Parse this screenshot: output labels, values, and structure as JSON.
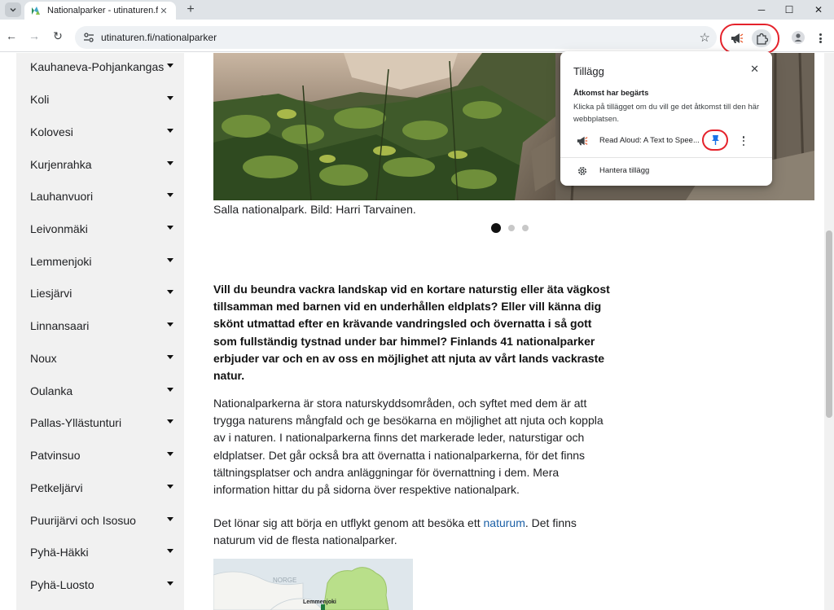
{
  "browser": {
    "tab": {
      "title": "Nationalparker - utinaturen.fi",
      "close_glyph": "✕"
    },
    "new_tab_glyph": "+",
    "window_controls": [
      "─",
      "☐",
      "✕"
    ],
    "url": "utinaturen.fi/nationalparker",
    "nav": {
      "back": "←",
      "forward": "→",
      "reload": "↻"
    },
    "bookmark_glyph": "☆",
    "accent_highlight": "#e5222b"
  },
  "sidebar": {
    "items": [
      "Kauhaneva-Pohjankangas",
      "Koli",
      "Kolovesi",
      "Kurjenrahka",
      "Lauhanvuori",
      "Leivonmäki",
      "Lemmenjoki",
      "Liesjärvi",
      "Linnansaari",
      "Noux",
      "Oulanka",
      "Pallas-Yllästunturi",
      "Patvinsuo",
      "Petkeljärvi",
      "Puurijärvi och Isosuo",
      "Pyhä-Häkki",
      "Pyhä-Luosto"
    ]
  },
  "main": {
    "caption": "Salla nationalpark. Bild: Harri Tarvainen.",
    "carousel": {
      "count": 3,
      "active": 1
    },
    "lead": "Vill du beundra vackra landskap vid en kortare naturstig eller äta vägkost tillsamman med barnen vid en underhållen eldplats? Eller vill känna dig skönt utmattad efter en krävande vandringsled och övernatta i så gott som fullständig tystnad under bar himmel? Finlands 41 nationalparker erbjuder var och en av oss en möjlighet att njuta av vårt lands vackraste natur.",
    "para1": "Nationalparkerna är stora naturskyddsområden, och syftet med dem är att trygga naturens mångfald och ge besökarna en möjlighet att njuta och koppla av i naturen. I nationalparkerna finns det markerade leder, naturstigar och eldplatser. Det går också bra att övernatta i nationalparkerna, för det finns tältningsplatser och andra anläggningar för övernattning i dem. Mera information hittar du på sidorna över respektive nationalpark.",
    "para2_before": "Det lönar sig att börja en utflykt genom att besöka ett ",
    "para2_link": "naturum",
    "para2_after": ". Det finns naturum vid de flesta nationalparker.",
    "map": {
      "label_country": "NORGE",
      "label_park": "Lemmenjoki"
    }
  },
  "popup": {
    "title": "Tillägg",
    "close_glyph": "✕",
    "subtitle": "Åtkomst har begärts",
    "description": "Klicka på tillägget om du vill ge det åtkomst till den här webbplatsen.",
    "extension_name": "Read Aloud: A Text to Spee...",
    "manage_label": "Hantera tillägg"
  }
}
